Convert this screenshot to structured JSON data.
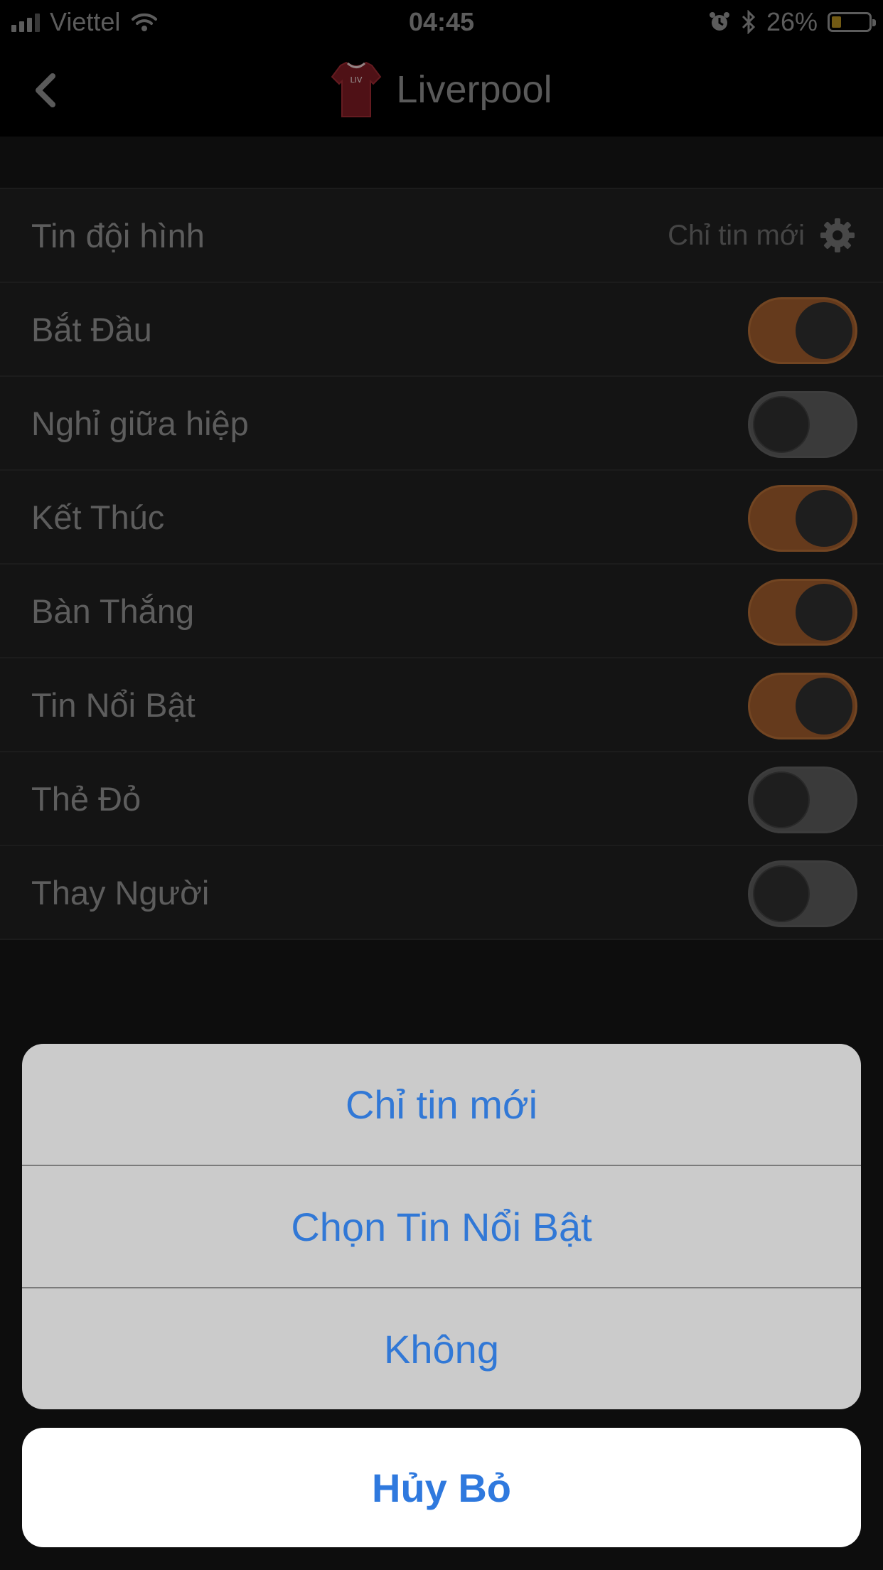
{
  "status_bar": {
    "carrier": "Viettel",
    "time": "04:45",
    "battery": "26%",
    "battery_level": 0.26
  },
  "nav": {
    "title": "Liverpool",
    "back_icon": "chevron-left-icon",
    "team_icon": "jersey-icon",
    "jersey_text": "LIV",
    "jersey_color": "#7a1b22"
  },
  "settings": {
    "lineup": {
      "label": "Tin đội hình",
      "value": "Chỉ tin mới",
      "icon": "gear-icon"
    },
    "toggles": [
      {
        "label": "Bắt Đầu",
        "on": true
      },
      {
        "label": "Nghỉ giữa hiệp",
        "on": false
      },
      {
        "label": "Kết Thúc",
        "on": true
      },
      {
        "label": "Bàn Thắng",
        "on": true
      },
      {
        "label": "Tin Nổi Bật",
        "on": true
      },
      {
        "label": "Thẻ Đỏ",
        "on": false
      },
      {
        "label": "Thay Người",
        "on": false
      }
    ]
  },
  "action_sheet": {
    "options": [
      "Chỉ tin mới",
      "Chọn Tin Nổi Bật",
      "Không"
    ],
    "cancel": "Hủy Bỏ"
  },
  "colors": {
    "toggle_on": "#9c5a2b",
    "toggle_off": "#595959",
    "action_text": "#3178d6"
  }
}
